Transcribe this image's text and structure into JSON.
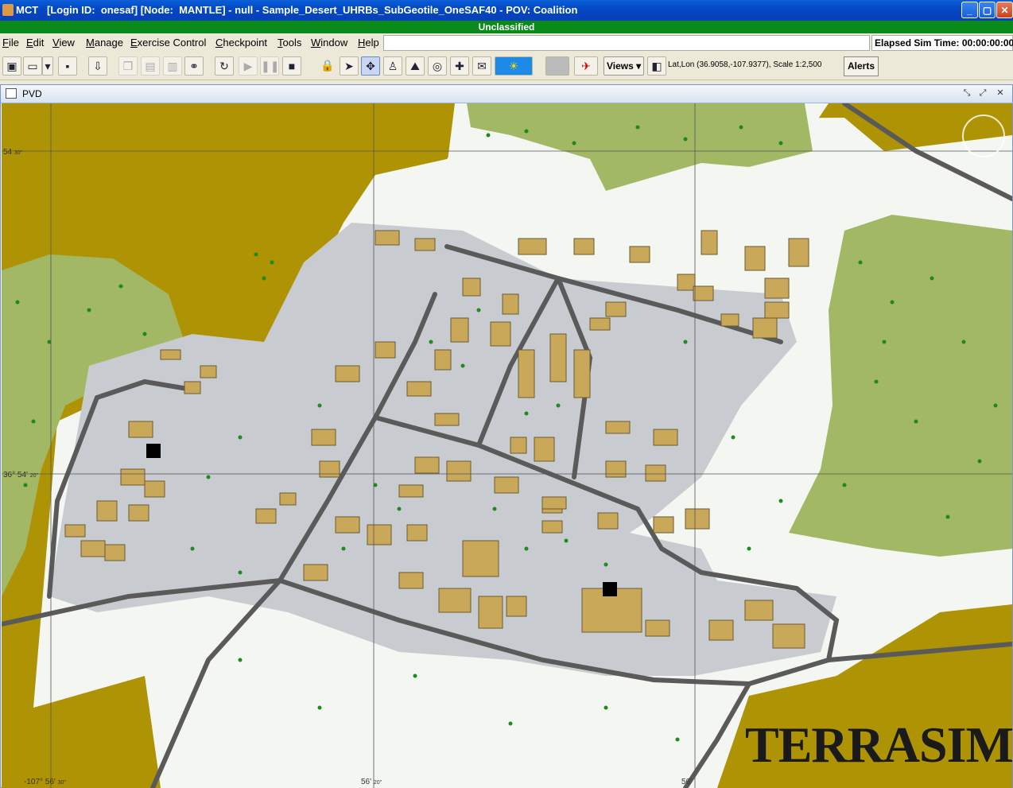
{
  "window": {
    "title": "MCT   [Login ID:  onesaf] [Node:  MANTLE] - null - Sample_Desert_UHRBs_SubGeotile_OneSAF40 - POV: Coalition",
    "classification": "Unclassified"
  },
  "menu": {
    "items": [
      {
        "key": "F",
        "rest": "ile"
      },
      {
        "key": "E",
        "rest": "dit"
      },
      {
        "key": "V",
        "rest": "iew"
      },
      {
        "key": "M",
        "rest": "anage"
      },
      {
        "key": "E",
        "rest": "xercise Control"
      },
      {
        "key": "C",
        "rest": "heckpoint"
      },
      {
        "key": "T",
        "rest": "ools"
      },
      {
        "key": "W",
        "rest": "indow"
      },
      {
        "key": "H",
        "rest": "elp"
      }
    ],
    "elapsed": "Elapsed Sim Time: 00:00:00:00"
  },
  "toolbar": {
    "views_label": "Views",
    "coords_text": "Lat,Lon (36.9058,-107.9377), Scale 1:2,500",
    "alerts_label": "Alerts"
  },
  "pvd": {
    "title": "PVD",
    "grid_labels": {
      "lat_top": "54",
      "lat_top_sec": "30\"",
      "lat_mid": "36° 54'",
      "lat_mid_sec": "20\"",
      "lon_left": "-107° 56'",
      "lon_left_sec": "30\"",
      "lon_mid": "56'",
      "lon_mid_sec": "20\"",
      "lon_right": "56'"
    },
    "logo_text": "TERRASIM"
  },
  "colors": {
    "desert": "#ae9305",
    "vegetation": "#a3b865",
    "urban": "#c8ccd0",
    "building": "#c9a85a",
    "road": "#5a5a5a",
    "tree": "#1e8a1e"
  }
}
